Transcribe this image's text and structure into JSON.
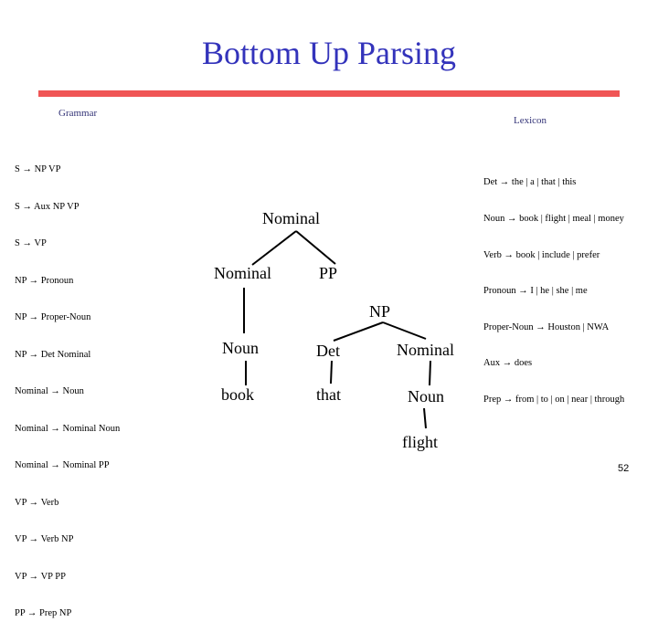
{
  "slide": {
    "title": "Bottom Up Parsing",
    "page_number": "52",
    "accent_colors": {
      "title": "#3333bb",
      "rule": "#f05555",
      "labels": "#333377"
    }
  },
  "grammar": {
    "label": "Grammar",
    "rules": [
      "S → NP VP",
      "S → Aux NP VP",
      "S → VP",
      "NP → Pronoun",
      "NP → Proper-Noun",
      "NP → Det Nominal",
      "Nominal → Noun",
      "Nominal → Nominal Noun",
      "Nominal → Nominal PP",
      "VP → Verb",
      "VP → Verb NP",
      "VP → VP PP",
      "PP → Prep NP"
    ]
  },
  "lexicon": {
    "label": "Lexicon",
    "rules": [
      "Det → the | a | that | this",
      "Noun → book | flight | meal | money",
      "Verb → book | include | prefer",
      "Pronoun → I | he | she | me",
      "Proper-Noun → Houston | NWA",
      "Aux → does",
      "Prep → from | to | on | near | through"
    ]
  },
  "tree": {
    "nodes": {
      "nominal_top": "Nominal",
      "nominal_left": "Nominal",
      "pp": "PP",
      "np": "NP",
      "noun_1": "Noun",
      "det": "Det",
      "nominal_right": "Nominal",
      "book": "book",
      "that": "that",
      "noun_2": "Noun",
      "flight": "flight"
    }
  }
}
